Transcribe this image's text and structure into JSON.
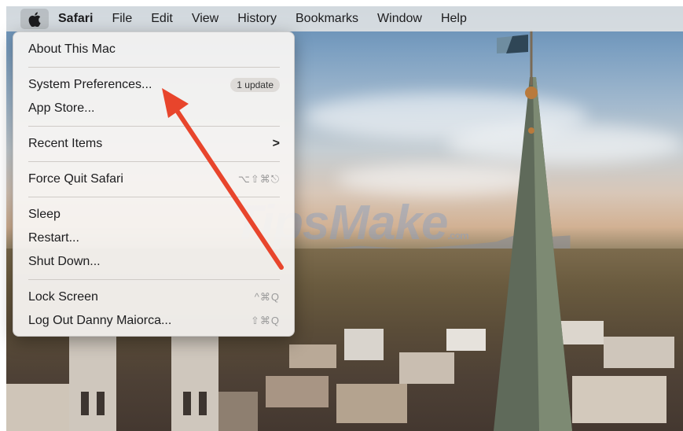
{
  "menubar": {
    "apple_icon": "apple-icon",
    "items": [
      "Safari",
      "File",
      "Edit",
      "View",
      "History",
      "Bookmarks",
      "Window",
      "Help"
    ]
  },
  "apple_menu": {
    "about": "About This Mac",
    "system_preferences": "System Preferences...",
    "update_badge": "1 update",
    "app_store": "App Store...",
    "recent_items": "Recent Items",
    "recent_items_chevron": ">",
    "force_quit": "Force Quit Safari",
    "force_quit_shortcut": "⌥⇧⌘⎋",
    "sleep": "Sleep",
    "restart": "Restart...",
    "shut_down": "Shut Down...",
    "lock_screen": "Lock Screen",
    "lock_screen_shortcut": "^⌘Q",
    "log_out": "Log Out Danny Maiorca...",
    "log_out_shortcut": "⇧⌘Q"
  },
  "annotation": {
    "arrow_color": "#e8452c"
  },
  "watermark": {
    "text": "TipsMake",
    "suffix": ".com"
  }
}
